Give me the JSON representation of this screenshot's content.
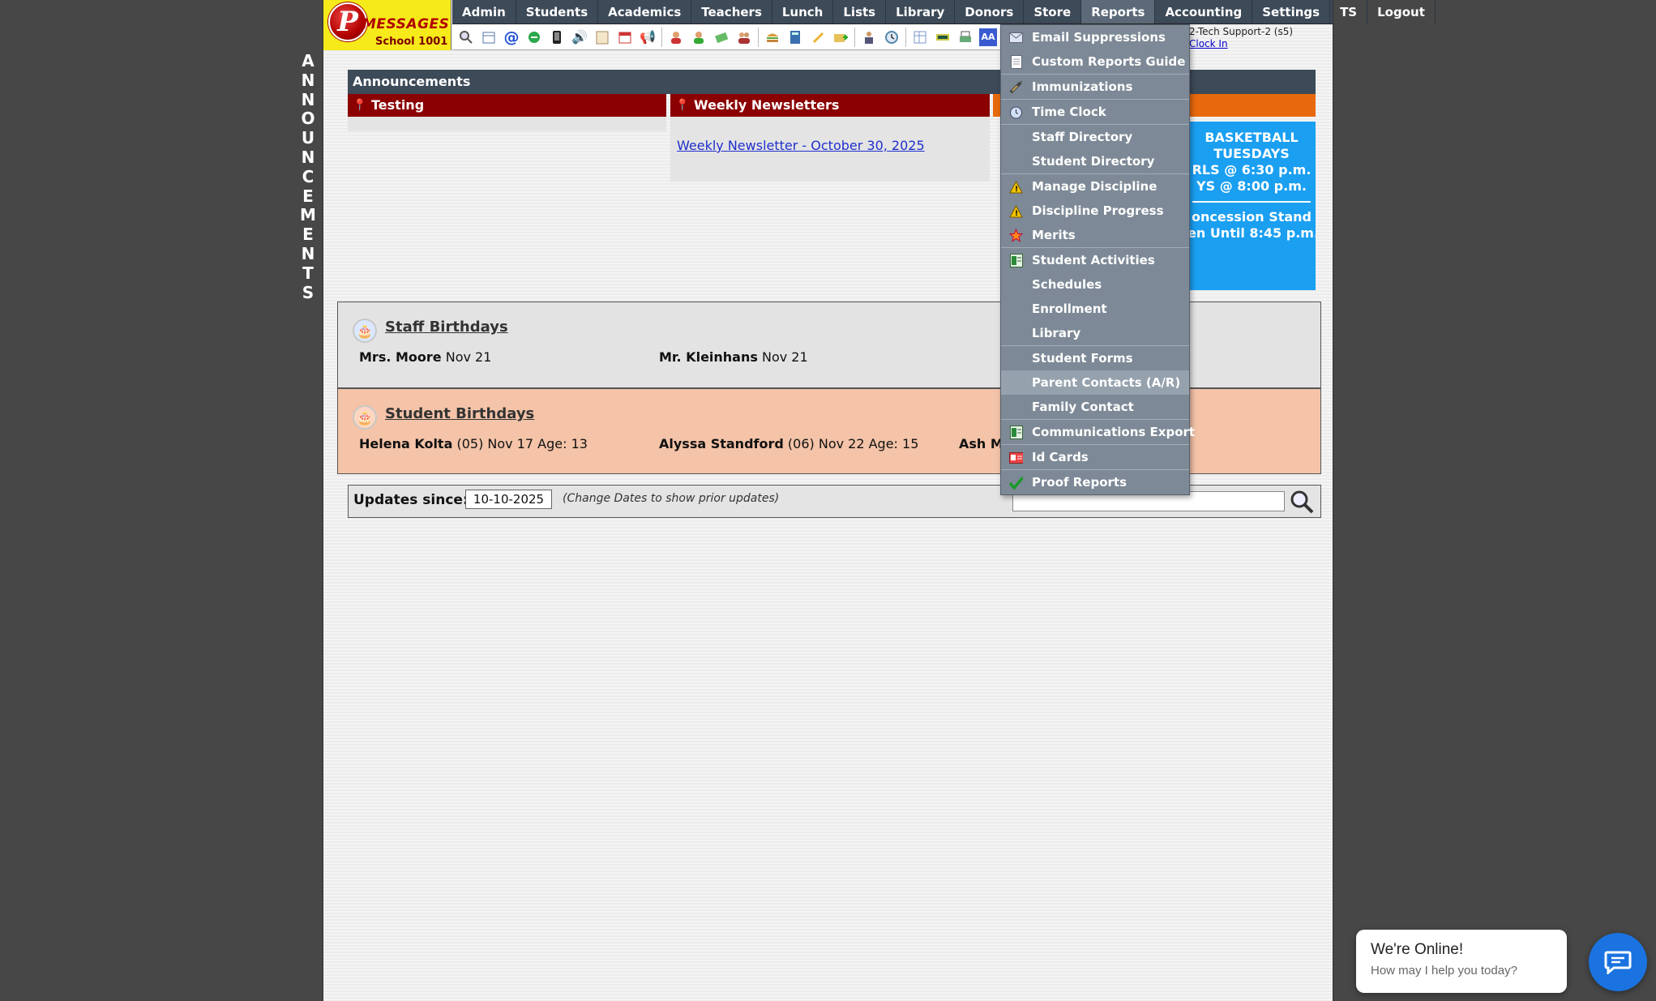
{
  "banner": {
    "letters": [
      "A",
      "N",
      "N",
      "O",
      "U",
      "N",
      "C",
      "E",
      "M",
      "E",
      "N",
      "T",
      "S"
    ]
  },
  "logo": {
    "letter": "P",
    "word": "MESSAGES",
    "school": "School 1001"
  },
  "nav": {
    "items": [
      "Admin",
      "Students",
      "Academics",
      "Teachers",
      "Lunch",
      "Lists",
      "Library",
      "Donors",
      "Store",
      "Reports",
      "Accounting",
      "Settings",
      "TS",
      "Logout"
    ],
    "active": "Reports"
  },
  "user": {
    "name": "2-Tech Support-2 (s5)",
    "clock_link": "Clock In"
  },
  "announcements": {
    "header": "Announcements",
    "panels": [
      {
        "title": "Testing"
      },
      {
        "title": "Weekly Newsletters",
        "link": "Weekly Newsletter - October 30, 2025"
      }
    ],
    "basketball": {
      "lines": [
        "BASKETBALL",
        "TUESDAYS",
        "RLS @ 6:30 p.m.",
        "YS  @ 8:00 p.m."
      ],
      "lines2": [
        "oncession Stand",
        "en Until 8:45 p.m."
      ]
    }
  },
  "birthdays": {
    "staff": {
      "title": "Staff Birthdays",
      "entries": [
        {
          "name": "Mrs. Moore",
          "detail": "Nov 21"
        },
        {
          "name": "Mr. Kleinhans",
          "detail": "Nov 21"
        }
      ]
    },
    "student": {
      "title": "Student Birthdays",
      "entries": [
        {
          "name": "Helena Kolta",
          "detail": "(05) Nov 17 Age: 13"
        },
        {
          "name": "Alyssa Standford",
          "detail": "(06) Nov 22 Age: 15"
        },
        {
          "name": "Ash M",
          "detail": ""
        }
      ]
    }
  },
  "updates": {
    "label": "Updates since:",
    "date": "10-10-2025",
    "hint": "(Change Dates to show prior updates)",
    "search_value": ""
  },
  "dropdown": {
    "items": [
      {
        "label": "Email Suppressions",
        "icon": "envelope-icon"
      },
      {
        "label": "Custom Reports Guide",
        "icon": "document-icon"
      },
      {
        "label": "Immunizations",
        "icon": "syringe-icon"
      },
      {
        "label": "Time Clock",
        "icon": "alarm-clock-icon"
      },
      {
        "label": "Staff Directory",
        "icon": ""
      },
      {
        "label": "Student Directory",
        "icon": ""
      },
      {
        "label": "Manage Discipline",
        "icon": "warning-icon"
      },
      {
        "label": "Discipline Progress",
        "icon": "warning-icon"
      },
      {
        "label": "Merits",
        "icon": "star-icon"
      },
      {
        "label": "Student Activities",
        "icon": "spreadsheet-icon"
      },
      {
        "label": "Schedules",
        "icon": ""
      },
      {
        "label": "Enrollment",
        "icon": ""
      },
      {
        "label": "Library",
        "icon": ""
      },
      {
        "label": "Student Forms",
        "icon": ""
      },
      {
        "label": "Parent Contacts (A/R)",
        "icon": ""
      },
      {
        "label": "Family Contact",
        "icon": ""
      },
      {
        "label": "Communications Export",
        "icon": "spreadsheet-icon"
      },
      {
        "label": "Id Cards",
        "icon": "id-card-icon"
      },
      {
        "label": "Proof Reports",
        "icon": "checkmark-icon"
      }
    ],
    "hovered": "Parent Contacts (A/R)"
  },
  "chat": {
    "title": "We're Online!",
    "subtitle": "How may I help you today?"
  },
  "colors": {
    "nav_bg": "#3d4a58",
    "dropdown_bg": "#7d8996",
    "announcement_red": "#8b0000",
    "basketball_blue": "#1a9ff1",
    "staff_bg": "#e3e3e3",
    "student_bg": "#f4c3a8",
    "chat_blue": "#1a73e0",
    "logo_yellow": "#f6ea1a"
  }
}
